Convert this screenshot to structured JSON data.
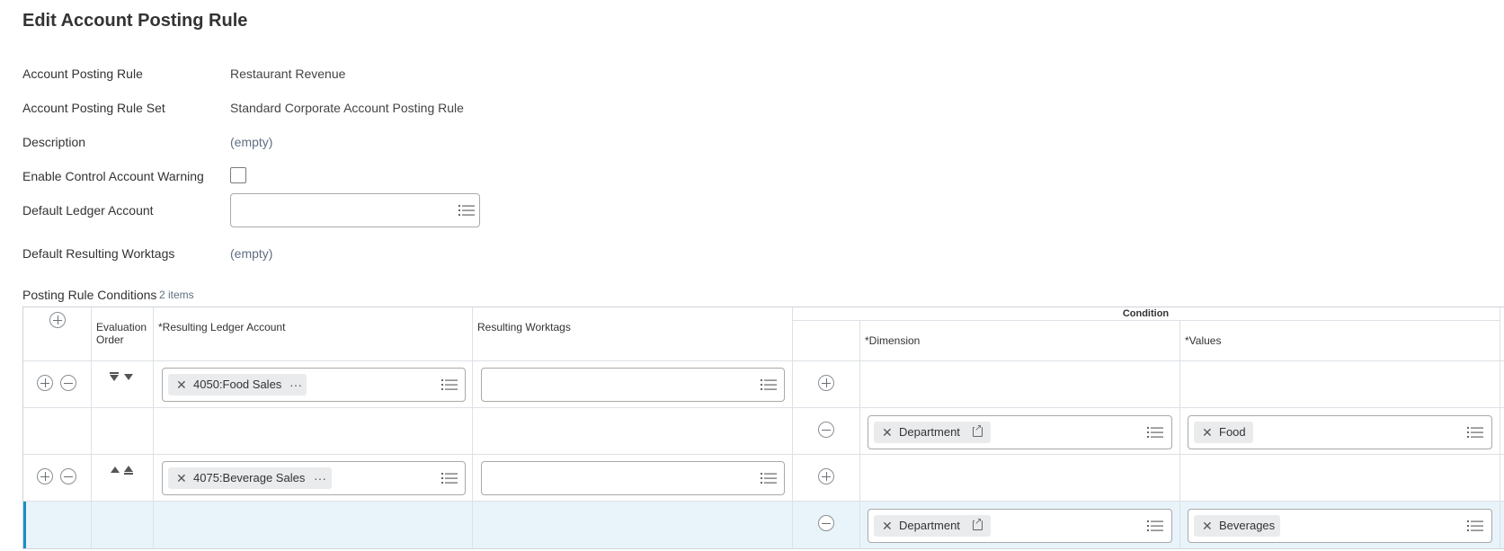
{
  "page": {
    "title": "Edit Account Posting Rule"
  },
  "fields": {
    "rule_label": "Account Posting Rule",
    "rule_value": "Restaurant Revenue",
    "rule_set_label": "Account Posting Rule Set",
    "rule_set_value": "Standard Corporate Account Posting Rule",
    "description_label": "Description",
    "description_value": "(empty)",
    "control_warning_label": "Enable Control Account Warning",
    "control_warning_checked": false,
    "default_ledger_label": "Default Ledger Account",
    "default_ledger_value": "",
    "default_worktags_label": "Default Resulting Worktags",
    "default_worktags_value": "(empty)"
  },
  "conditions": {
    "title": "Posting Rule Conditions",
    "count": "2 items",
    "headers": {
      "evaluation_order": "Evaluation Order",
      "resulting_ledger_account": "*Resulting Ledger Account",
      "resulting_worktags": "Resulting Worktags",
      "condition": "Condition",
      "dimension": "*Dimension",
      "values": "*Values"
    },
    "rows": [
      {
        "ledger_account": "4050:Food Sales",
        "worktags": "",
        "dimension": "Department",
        "value": "Food"
      },
      {
        "ledger_account": "4075:Beverage Sales",
        "worktags": "",
        "dimension": "Department",
        "value": "Beverages"
      }
    ]
  },
  "icons": {
    "prompt": "list-icon",
    "add": "plus-circle-icon",
    "remove": "minus-circle-icon",
    "remove_tag": "x-icon",
    "related_actions": "ellipsis-icon",
    "external": "external-link-icon",
    "move_bottom": "move-to-bottom-icon",
    "move_down": "move-down-icon",
    "move_up": "move-up-icon",
    "move_top": "move-to-top-icon"
  },
  "colors": {
    "selected_row_bg": "#e8f4fa",
    "selected_row_border": "#3ea6d8",
    "pill_bg": "#e9ebed",
    "empty_text": "#5f6f80"
  }
}
